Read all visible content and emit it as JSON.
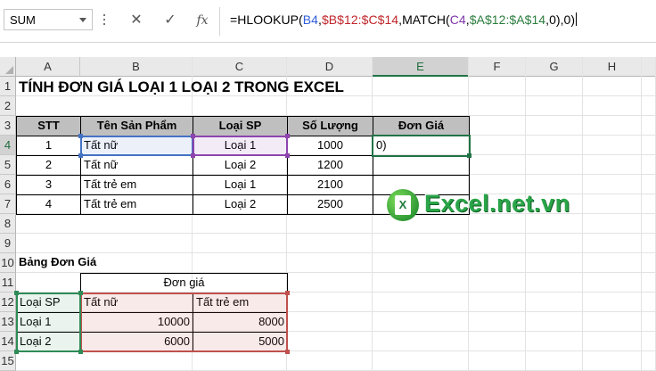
{
  "formula_bar": {
    "name_box": "SUM",
    "cancel_icon": "✕",
    "enter_icon": "✓",
    "fx_icon": "fx",
    "formula_parts": [
      {
        "text": "=HLOOKUP(",
        "color": "black"
      },
      {
        "text": "B4",
        "color": "blue"
      },
      {
        "text": ",",
        "color": "black"
      },
      {
        "text": "$B$12:$C$14",
        "color": "red"
      },
      {
        "text": ",MATCH(",
        "color": "black"
      },
      {
        "text": "C4",
        "color": "purple"
      },
      {
        "text": ",",
        "color": "black"
      },
      {
        "text": "$A$12:$A$14",
        "color": "green"
      },
      {
        "text": ",0),0)",
        "color": "black"
      }
    ]
  },
  "columns": [
    "A",
    "B",
    "C",
    "D",
    "E",
    "F",
    "G",
    "H"
  ],
  "rows": [
    "1",
    "2",
    "3",
    "4",
    "5",
    "6",
    "7",
    "8",
    "9",
    "10",
    "11",
    "12",
    "13",
    "14",
    "15"
  ],
  "selected": {
    "column": "E",
    "row": "4"
  },
  "sheet": {
    "title": "TÍNH ĐƠN GIÁ LOẠI 1 LOẠI 2 TRONG EXCEL",
    "main_table": {
      "headers": [
        "STT",
        "Tên Sản Phẩm",
        "Loại SP",
        "Số Lượng",
        "Đơn Giá"
      ],
      "rows": [
        {
          "stt": "1",
          "name": "Tất nữ",
          "type": "Loại 1",
          "qty": "1000",
          "price": "0)"
        },
        {
          "stt": "2",
          "name": "Tất nữ",
          "type": "Loại 2",
          "qty": "1200",
          "price": ""
        },
        {
          "stt": "3",
          "name": "Tất trẻ em",
          "type": "Loại 1",
          "qty": "2100",
          "price": ""
        },
        {
          "stt": "4",
          "name": "Tất trẻ em",
          "type": "Loại 2",
          "qty": "2500",
          "price": ""
        }
      ]
    },
    "price_table": {
      "label": "Bảng Đơn Giá",
      "group_header": "Đơn giá",
      "corner_label": "Loại SP",
      "col_headers": [
        "Tất nữ",
        "Tất trẻ em"
      ],
      "rows": [
        {
          "type": "Loại 1",
          "values": [
            "10000",
            "8000"
          ]
        },
        {
          "type": "Loại 2",
          "values": [
            "6000",
            "5000"
          ]
        }
      ]
    }
  },
  "watermark": {
    "text": "Excel.net.vn",
    "icon_letter": "X"
  },
  "colors": {
    "blue": "#2f5ed8",
    "red": "#c0262c",
    "purple": "#7d36a8",
    "green": "#2c7d3e",
    "header_fill": "#bfbfbf",
    "active_border": "#217346"
  }
}
